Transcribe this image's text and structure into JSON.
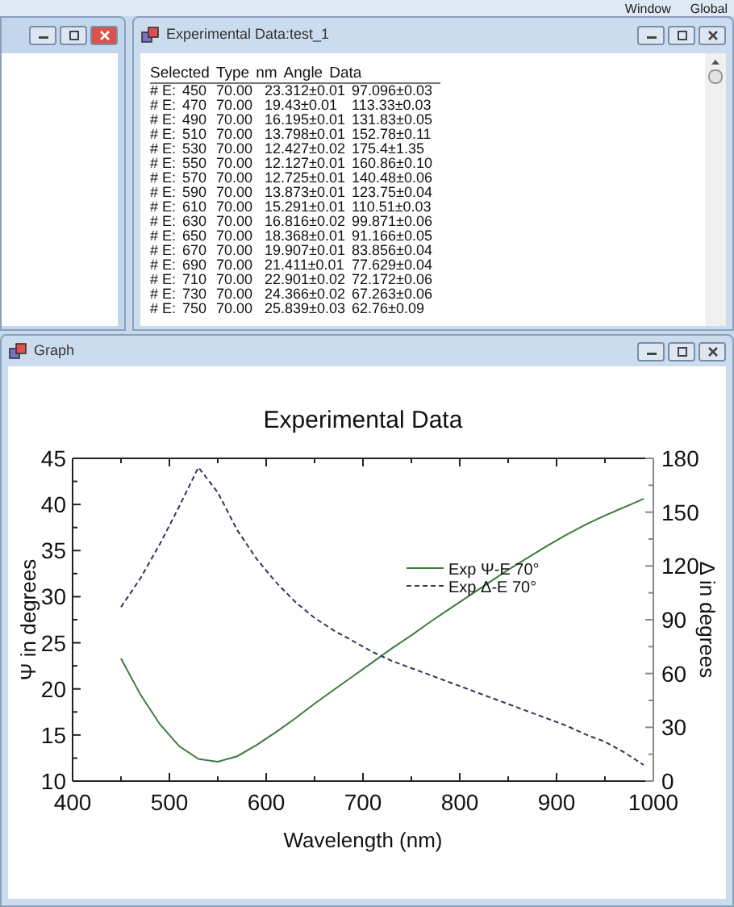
{
  "menu_bar": {
    "items": [
      "Window",
      "Global"
    ]
  },
  "data_window": {
    "title": "Experimental Data:test_1",
    "columns": [
      "Selected",
      "Type",
      "nm",
      "Angle",
      "Data"
    ],
    "rows": [
      {
        "type": "# E:",
        "nm": "450",
        "angle": "70.00",
        "psi": "23.312±0.01",
        "delta": "97.096±0.03"
      },
      {
        "type": "# E:",
        "nm": "470",
        "angle": "70.00",
        "psi": "19.43±0.01",
        "delta": "113.33±0.03"
      },
      {
        "type": "# E:",
        "nm": "490",
        "angle": "70.00",
        "psi": "16.195±0.01",
        "delta": "131.83±0.05"
      },
      {
        "type": "# E:",
        "nm": "510",
        "angle": "70.00",
        "psi": "13.798±0.01",
        "delta": "152.78±0.11"
      },
      {
        "type": "# E:",
        "nm": "530",
        "angle": "70.00",
        "psi": "12.427±0.02",
        "delta": "175.4±1.35"
      },
      {
        "type": "# E:",
        "nm": "550",
        "angle": "70.00",
        "psi": "12.127±0.01",
        "delta": "160.86±0.10"
      },
      {
        "type": "# E:",
        "nm": "570",
        "angle": "70.00",
        "psi": "12.725±0.01",
        "delta": "140.48±0.06"
      },
      {
        "type": "# E:",
        "nm": "590",
        "angle": "70.00",
        "psi": "13.873±0.01",
        "delta": "123.75±0.04"
      },
      {
        "type": "# E:",
        "nm": "610",
        "angle": "70.00",
        "psi": "15.291±0.01",
        "delta": "110.51±0.03"
      },
      {
        "type": "# E:",
        "nm": "630",
        "angle": "70.00",
        "psi": "16.816±0.02",
        "delta": "99.871±0.06"
      },
      {
        "type": "# E:",
        "nm": "650",
        "angle": "70.00",
        "psi": "18.368±0.01",
        "delta": "91.166±0.05"
      },
      {
        "type": "# E:",
        "nm": "670",
        "angle": "70.00",
        "psi": "19.907±0.01",
        "delta": "83.856±0.04"
      },
      {
        "type": "# E:",
        "nm": "690",
        "angle": "70.00",
        "psi": "21.411±0.01",
        "delta": "77.629±0.04"
      },
      {
        "type": "# E:",
        "nm": "710",
        "angle": "70.00",
        "psi": "22.901±0.02",
        "delta": "72.172±0.06"
      },
      {
        "type": "# E:",
        "nm": "730",
        "angle": "70.00",
        "psi": "24.366±0.02",
        "delta": "67.263±0.06"
      },
      {
        "type": "# E:",
        "nm": "750",
        "angle": "70.00",
        "psi": "25.839±0.03",
        "delta": "62.76±0.09"
      }
    ]
  },
  "graph_window": {
    "title": "Graph",
    "chart_data": {
      "type": "line",
      "title": "Experimental Data",
      "xlabel": "Wavelength (nm)",
      "ylabel": "Ψ in degrees",
      "y2label": "Δ in degrees",
      "x": [
        450,
        470,
        490,
        510,
        530,
        550,
        570,
        590,
        610,
        630,
        650,
        670,
        690,
        710,
        730,
        750,
        770,
        790,
        810,
        830,
        850,
        870,
        890,
        910,
        930,
        950,
        970,
        990
      ],
      "xlim": [
        400,
        1000
      ],
      "ylim": [
        10,
        45
      ],
      "y2lim": [
        0,
        180
      ],
      "legend": "center right",
      "xticks": [
        400,
        500,
        600,
        700,
        800,
        900,
        1000
      ],
      "yticks": [
        10,
        15,
        20,
        25,
        30,
        35,
        40,
        45
      ],
      "y2ticks": [
        0,
        30,
        60,
        90,
        120,
        150,
        180
      ],
      "series": [
        {
          "name": "Exp Ψ-E 70°",
          "color": "#3f7a3f",
          "values": [
            23.3,
            19.4,
            16.2,
            13.8,
            12.4,
            12.1,
            12.7,
            13.9,
            15.3,
            16.8,
            18.4,
            19.9,
            21.4,
            22.9,
            24.4,
            25.8,
            27.3,
            28.7,
            30.1,
            31.5,
            32.9,
            34.2,
            35.5,
            36.7,
            37.8,
            38.8,
            39.7,
            40.6
          ]
        },
        {
          "name": "Exp Δ-E 70°",
          "color": "#33335a",
          "axis": "y2",
          "line_style": "dashed",
          "values": [
            97,
            113,
            132,
            153,
            175,
            161,
            140,
            124,
            111,
            100,
            91,
            84,
            78,
            72,
            67,
            63,
            59,
            55,
            51,
            47,
            43,
            39,
            35,
            31,
            26,
            22,
            16,
            9
          ]
        }
      ]
    }
  }
}
